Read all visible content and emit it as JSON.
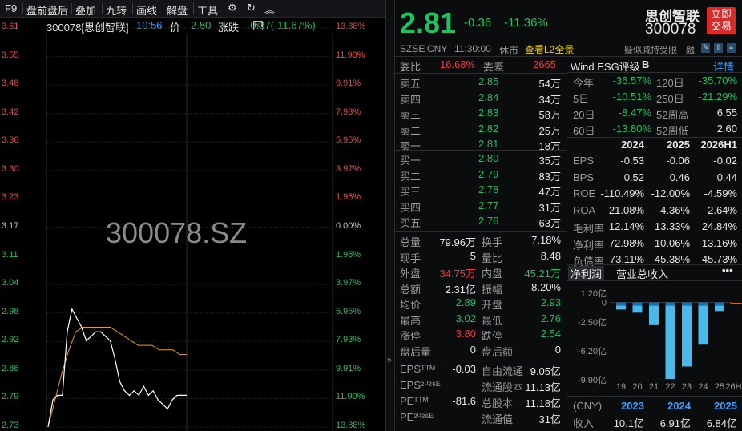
{
  "toolbar": {
    "items": [
      "F9",
      "盘前盘后",
      "叠加",
      "九转",
      "画线",
      "解盘",
      "工具"
    ],
    "settings_icon": "gear-icon",
    "refresh_icon": "refresh-icon",
    "collapse_icon": "chevron-up-icon"
  },
  "chart_header": {
    "code_name": "300078[思创智联]",
    "time": "10:56",
    "price_label": "价",
    "price": "2.80",
    "change_label": "涨跌",
    "change": "-0.37(-11.67%)"
  },
  "watermark": "300078.SZ",
  "chart_data": {
    "type": "line",
    "y_ticks_left": [
      "3.61",
      "3.55",
      "3.48",
      "3.42",
      "3.36",
      "3.30",
      "3.23",
      "3.17",
      "3.11",
      "3.04",
      "2.98",
      "2.92",
      "2.86",
      "2.79",
      "2.73"
    ],
    "y_ticks_right": [
      "13.88%",
      "11.90%",
      "9.91%",
      "7.93%",
      "5.95%",
      "3.97%",
      "1.98%",
      "0.00%",
      "1.98%",
      "3.97%",
      "5.95%",
      "7.93%",
      "9.91%",
      "11.90%",
      "13.88%"
    ],
    "ylim": [
      2.73,
      3.61
    ],
    "prev_close": 3.17,
    "price_series": [
      2.73,
      2.79,
      2.8,
      2.8,
      2.94,
      2.99,
      2.97,
      2.95,
      2.92,
      2.93,
      2.94,
      2.94,
      2.93,
      2.92,
      2.88,
      2.83,
      2.81,
      2.8,
      2.81,
      2.8,
      2.82,
      2.8,
      2.81,
      2.79,
      2.78,
      2.77,
      2.79,
      2.8,
      2.8,
      2.8
    ],
    "avg_series": [
      2.73,
      2.79,
      2.85,
      2.9,
      2.94,
      2.95,
      2.95,
      2.95,
      2.95,
      2.95,
      2.94,
      2.93,
      2.92,
      2.91,
      2.91,
      2.91,
      2.9,
      2.9,
      2.9,
      2.89,
      2.89
    ]
  },
  "quote": {
    "price": "2.81",
    "change": "-0.36",
    "pct": "-11.36%",
    "name": "思创智联",
    "code": "300078",
    "trade_btn": [
      "立即",
      "交易"
    ],
    "market": "SZSE",
    "currency": "CNY",
    "time": "11:30:00",
    "status": "休市",
    "l2_link": "查看L2全景",
    "risk_tag": "疑似减持受限",
    "margin_tag": "融"
  },
  "order_book": {
    "ratio_label": "委比",
    "ratio": "16.68%",
    "diff_label": "委差",
    "diff": "2665",
    "asks": [
      {
        "label": "卖五",
        "price": "2.85",
        "vol": "54万"
      },
      {
        "label": "卖四",
        "price": "2.84",
        "vol": "34万"
      },
      {
        "label": "卖三",
        "price": "2.83",
        "vol": "58万"
      },
      {
        "label": "卖二",
        "price": "2.82",
        "vol": "25万"
      },
      {
        "label": "卖一",
        "price": "2.81",
        "vol": "18万"
      }
    ],
    "bids": [
      {
        "label": "买一",
        "price": "2.80",
        "vol": "35万"
      },
      {
        "label": "买二",
        "price": "2.79",
        "vol": "83万"
      },
      {
        "label": "买三",
        "price": "2.78",
        "vol": "47万"
      },
      {
        "label": "买四",
        "price": "2.77",
        "vol": "31万"
      },
      {
        "label": "买五",
        "price": "2.76",
        "vol": "63万"
      }
    ]
  },
  "stats": [
    [
      "总量",
      "79.96万",
      "换手",
      "7.18%"
    ],
    [
      "现手",
      "5",
      "量比",
      "8.48"
    ],
    [
      "外盘",
      "34.75万",
      "内盘",
      "45.21万"
    ],
    [
      "总额",
      "2.31亿",
      "振幅",
      "8.20%"
    ],
    [
      "均价",
      "2.89",
      "开盘",
      "2.93"
    ],
    [
      "最高",
      "3.02",
      "最低",
      "2.76"
    ],
    [
      "涨停",
      "3.80",
      "跌停",
      "2.54"
    ],
    [
      "盘后量",
      "0",
      "盘后额",
      "0"
    ]
  ],
  "fin_stats": [
    [
      "EPSᵀᵀᴹ",
      "-0.03",
      "自由流通",
      "9.05亿"
    ],
    [
      "EPS²⁰²⁶ᴱ",
      "",
      "流通股本",
      "11.13亿"
    ],
    [
      "PEᵀᵀᴹ",
      "-81.6",
      "总股本",
      "11.18亿"
    ],
    [
      "PE²⁰²⁶ᴱ",
      "",
      "流通值",
      "31亿"
    ]
  ],
  "wind": {
    "title": "Wind ESG评级",
    "rating": "B",
    "detail": "详情",
    "perf": [
      [
        "今年",
        "-36.57%",
        "120日",
        "-35.70%"
      ],
      [
        "5日",
        "-10.51%",
        "250日",
        "-21.29%"
      ],
      [
        "20日",
        "-8.47%",
        "52周高",
        "6.55"
      ],
      [
        "60日",
        "-13.80%",
        "52周低",
        "2.60"
      ]
    ],
    "years": [
      "2024",
      "2025",
      "2026H1"
    ],
    "fin": [
      [
        "EPS",
        "-0.53",
        "-0.06",
        "-0.02"
      ],
      [
        "BPS",
        "0.52",
        "0.46",
        "0.44"
      ],
      [
        "ROE",
        "-110.49%",
        "-12.00%",
        "-4.59%"
      ],
      [
        "ROA",
        "-21.08%",
        "-4.36%",
        "-2.64%"
      ],
      [
        "毛利率",
        "12.14%",
        "13.33%",
        "24.84%"
      ],
      [
        "净利率",
        "72.98%",
        "-10.06%",
        "-13.16%"
      ],
      [
        "负债率",
        "73.11%",
        "45.38%",
        "45.73%"
      ]
    ]
  },
  "bar_chart": {
    "tabs": [
      "净利润",
      "营业总收入"
    ],
    "more_icon": "more-icon",
    "y_ticks": [
      "1.20亿",
      "0",
      "-2.50亿",
      "-6.20亿",
      "-9.90亿"
    ],
    "x_ticks": [
      "19",
      "20",
      "21",
      "22",
      "23",
      "24",
      "25",
      "26H1"
    ],
    "values": [
      -0.9,
      -1.3,
      -2.9,
      -9.8,
      -8.2,
      -5.4,
      -1.1,
      -0.1
    ],
    "currency": "(CNY)",
    "years": [
      "2023",
      "2024",
      "2025"
    ],
    "revenue_label": "收入",
    "revenue": [
      "10.1亿",
      "6.91亿",
      "6.84亿"
    ]
  }
}
